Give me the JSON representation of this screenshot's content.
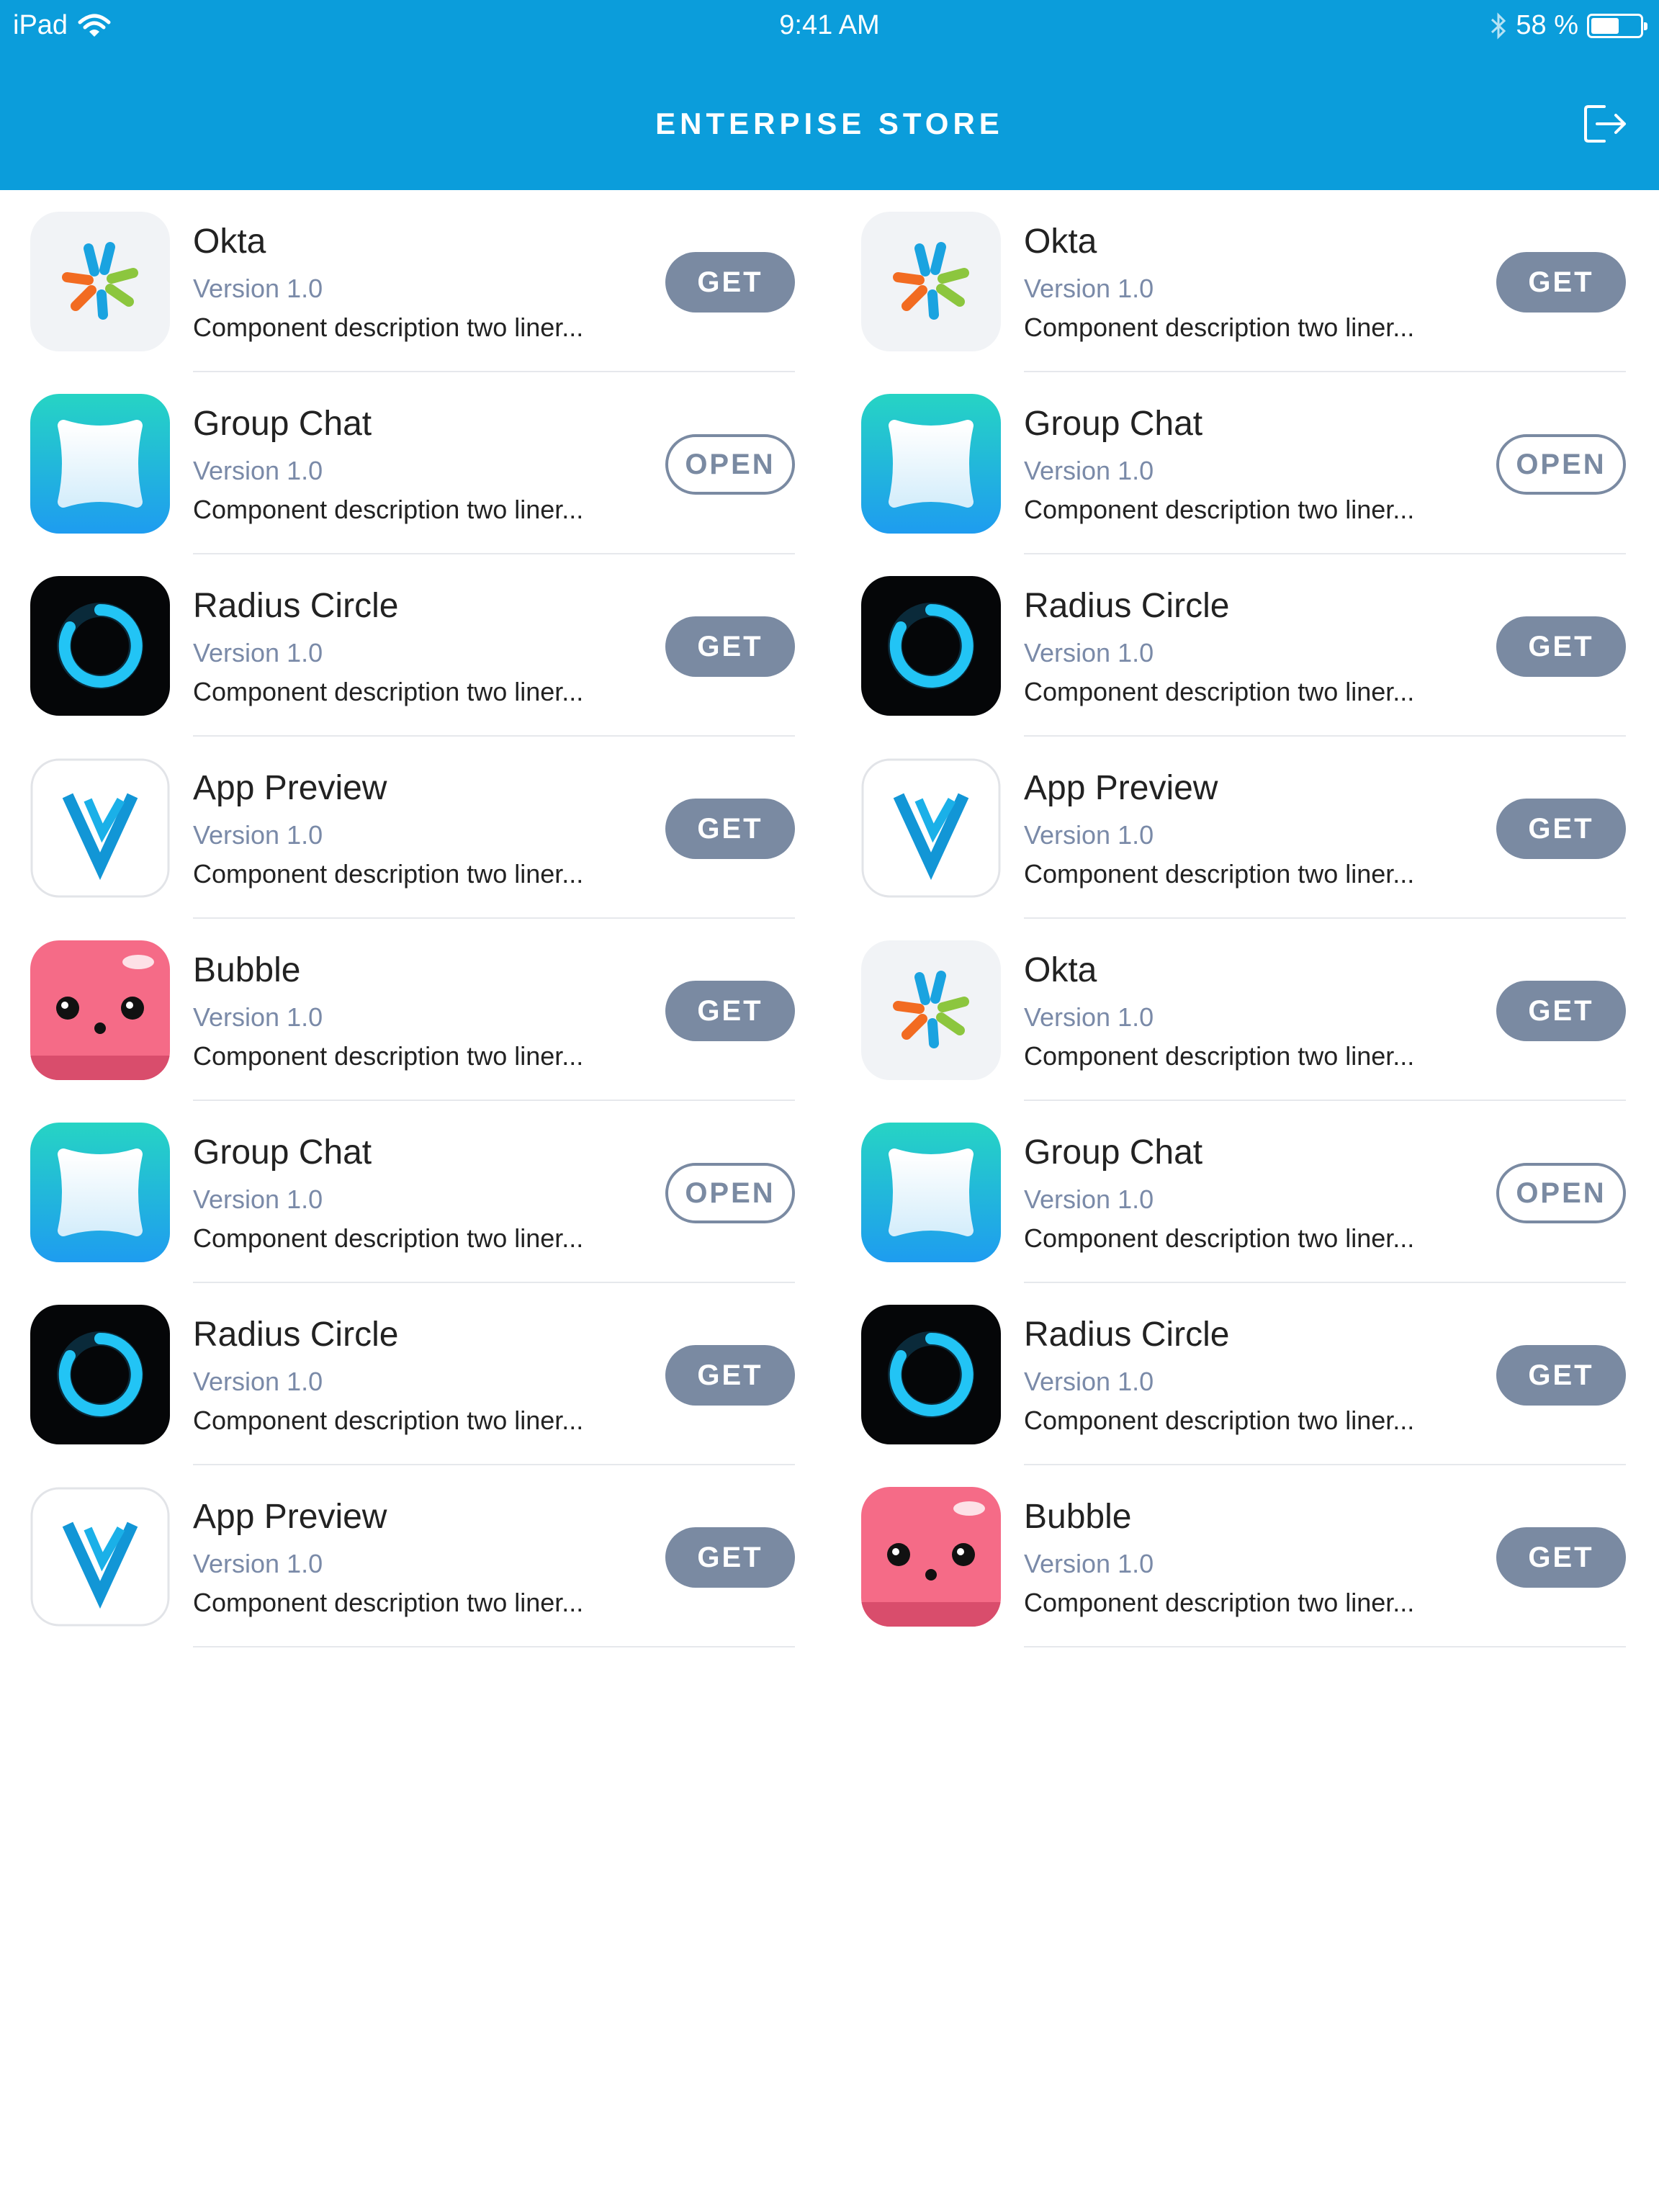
{
  "status_bar": {
    "carrier": "iPad",
    "time": "9:41 AM",
    "battery": "58 %",
    "battery_level": 0.58
  },
  "header": {
    "title": "ENTERPISE STORE",
    "logout_icon": "logout-icon"
  },
  "colors": {
    "header_bg": "#0b9ddb",
    "button": "#7a8aa2",
    "version_text": "#7a8aa8"
  },
  "apps": [
    {
      "name": "Okta",
      "version": "Version 1.0",
      "description": "Component description two liner...",
      "button": "GET",
      "icon": "okta"
    },
    {
      "name": "Okta",
      "version": "Version 1.0",
      "description": "Component description two liner...",
      "button": "GET",
      "icon": "okta"
    },
    {
      "name": "Group Chat",
      "version": "Version 1.0",
      "description": "Component description two liner...",
      "button": "OPEN",
      "icon": "groupchat"
    },
    {
      "name": "Group Chat",
      "version": "Version 1.0",
      "description": "Component description two liner...",
      "button": "OPEN",
      "icon": "groupchat"
    },
    {
      "name": "Radius Circle",
      "version": "Version 1.0",
      "description": "Component description two liner...",
      "button": "GET",
      "icon": "radius"
    },
    {
      "name": "Radius Circle",
      "version": "Version 1.0",
      "description": "Component description two liner...",
      "button": "GET",
      "icon": "radius"
    },
    {
      "name": "App Preview",
      "version": "Version 1.0",
      "description": "Component description two liner...",
      "button": "GET",
      "icon": "apppreview"
    },
    {
      "name": "App Preview",
      "version": "Version 1.0",
      "description": "Component description two liner...",
      "button": "GET",
      "icon": "apppreview"
    },
    {
      "name": "Bubble",
      "version": "Version 1.0",
      "description": "Component description two liner...",
      "button": "GET",
      "icon": "bubble"
    },
    {
      "name": "Okta",
      "version": "Version 1.0",
      "description": "Component description two liner...",
      "button": "GET",
      "icon": "okta"
    },
    {
      "name": "Group Chat",
      "version": "Version 1.0",
      "description": "Component description two liner...",
      "button": "OPEN",
      "icon": "groupchat"
    },
    {
      "name": "Group Chat",
      "version": "Version 1.0",
      "description": "Component description two liner...",
      "button": "OPEN",
      "icon": "groupchat"
    },
    {
      "name": "Radius Circle",
      "version": "Version 1.0",
      "description": "Component description two liner...",
      "button": "GET",
      "icon": "radius"
    },
    {
      "name": "Radius Circle",
      "version": "Version 1.0",
      "description": "Component description two liner...",
      "button": "GET",
      "icon": "radius"
    },
    {
      "name": "App Preview",
      "version": "Version 1.0",
      "description": "Component description two liner...",
      "button": "GET",
      "icon": "apppreview"
    },
    {
      "name": "Bubble",
      "version": "Version 1.0",
      "description": "Component description two liner...",
      "button": "GET",
      "icon": "bubble"
    }
  ]
}
